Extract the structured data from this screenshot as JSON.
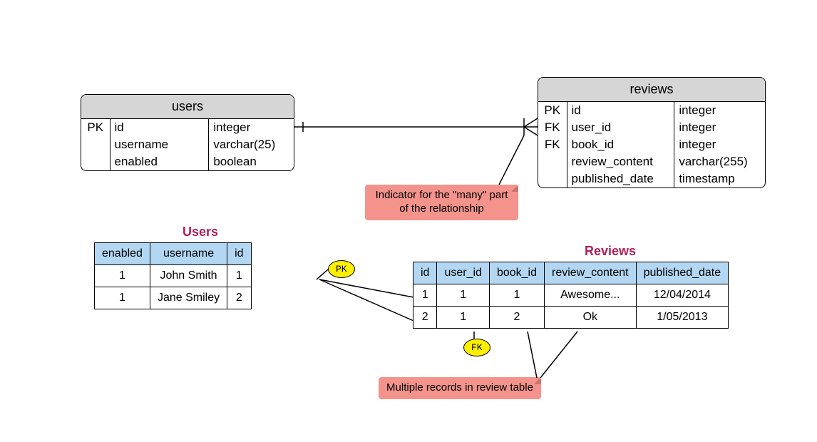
{
  "schemas": {
    "users": {
      "name": "users",
      "rows": [
        {
          "key": "PK",
          "col": "id",
          "type": "integer"
        },
        {
          "key": "",
          "col": "username",
          "type": "varchar(25)"
        },
        {
          "key": "",
          "col": "enabled",
          "type": "boolean"
        }
      ]
    },
    "reviews": {
      "name": "reviews",
      "rows": [
        {
          "key": "PK",
          "col": "id",
          "type": "integer"
        },
        {
          "key": "FK",
          "col": "user_id",
          "type": "integer"
        },
        {
          "key": "FK",
          "col": "book_id",
          "type": "integer"
        },
        {
          "key": "",
          "col": "review_content",
          "type": "varchar(255)"
        },
        {
          "key": "",
          "col": "published_date",
          "type": "timestamp"
        }
      ]
    }
  },
  "dataTables": {
    "users": {
      "title": "Users",
      "headers": [
        "enabled",
        "username",
        "id"
      ],
      "rows": [
        [
          "1",
          "John Smith",
          "1"
        ],
        [
          "1",
          "Jane Smiley",
          "2"
        ]
      ]
    },
    "reviews": {
      "title": "Reviews",
      "headers": [
        "id",
        "user_id",
        "book_id",
        "review_content",
        "published_date"
      ],
      "rows": [
        [
          "1",
          "1",
          "1",
          "Awesome...",
          "12/04/2014"
        ],
        [
          "2",
          "1",
          "2",
          "Ok",
          "1/05/2013"
        ]
      ]
    }
  },
  "notes": {
    "many": "Indicator for the \"many\" part of the relationship",
    "multi": "Multiple records in review table"
  },
  "pills": {
    "pk": "PK",
    "fk": "FK"
  }
}
